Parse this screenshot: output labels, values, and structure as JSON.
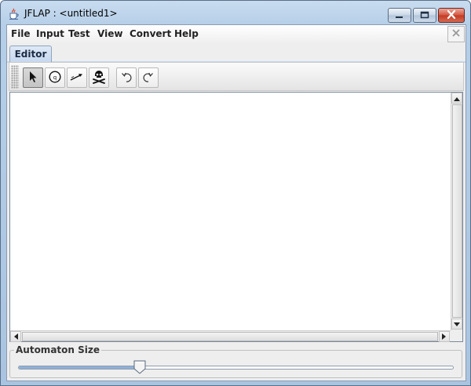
{
  "window": {
    "title": "JFLAP : <untitled1>",
    "icons": {
      "app": "java-cup-icon",
      "minimize": "minimize-icon",
      "maximize": "maximize-icon",
      "close": "close-icon"
    },
    "colors": {
      "close_button": "#c94a36",
      "frame": "#b6cfe8"
    }
  },
  "menubar": {
    "items": [
      {
        "label": "File"
      },
      {
        "label": "Input"
      },
      {
        "label": "Test"
      },
      {
        "label": "View"
      },
      {
        "label": "Convert"
      },
      {
        "label": "Help"
      }
    ],
    "close_icon": "close-icon"
  },
  "tabs": [
    {
      "label": "Editor",
      "selected": true
    }
  ],
  "toolbar": {
    "tools": [
      {
        "icon": "pointer-arrow-icon",
        "selected": true
      },
      {
        "icon": "state-creator-icon",
        "selected": false
      },
      {
        "icon": "transition-creator-icon",
        "selected": false
      },
      {
        "icon": "deleter-skull-icon",
        "selected": false
      },
      {
        "icon": "undo-icon",
        "selected": false
      },
      {
        "icon": "redo-icon",
        "selected": false
      }
    ]
  },
  "automaton_size": {
    "label": "Automaton Size",
    "level": 0.28
  }
}
